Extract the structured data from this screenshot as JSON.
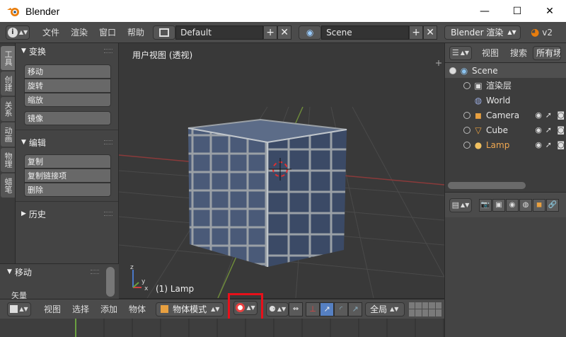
{
  "window": {
    "title": "Blender",
    "minimize": "—",
    "maximize": "☐",
    "close": "✕"
  },
  "topbar": {
    "info_icon": "i",
    "menus": [
      "文件",
      "渲染",
      "窗口",
      "帮助"
    ],
    "screen_layout": "Default",
    "scene": "Scene",
    "render_engine": "Blender 渲染",
    "version": "v2"
  },
  "left_tabs": [
    "工具",
    "创建",
    "关系",
    "动画",
    "物理",
    "蜡笔"
  ],
  "toolshelf": {
    "transform_header": "变换",
    "transform_buttons": [
      "移动",
      "旋转",
      "缩放"
    ],
    "mirror_button": "镜像",
    "edit_header": "编辑",
    "edit_buttons": [
      "复制",
      "复制链接项",
      "删除"
    ],
    "history_header": "历史"
  },
  "last_operator": {
    "header": "移动",
    "field_label": "矢量"
  },
  "viewport": {
    "title": "用户视图 (透视)",
    "active_object": "(1) Lamp",
    "axis_x": "x",
    "axis_y": "y",
    "axis_z": "z"
  },
  "bottom_header": {
    "menus": [
      "视图",
      "选择",
      "添加",
      "物体"
    ],
    "mode": "物体模式",
    "orientation": "全局"
  },
  "outliner": {
    "view_menu": "视图",
    "search_menu": "搜索",
    "filter": "所有场",
    "rows": [
      {
        "label": "Scene",
        "icon": "scene-icon"
      },
      {
        "label": "渲染层",
        "icon": "render-layer-icon"
      },
      {
        "label": "World",
        "icon": "world-icon"
      },
      {
        "label": "Camera",
        "icon": "camera-icon"
      },
      {
        "label": "Cube",
        "icon": "mesh-icon"
      },
      {
        "label": "Lamp",
        "icon": "lamp-icon"
      }
    ]
  },
  "colors": {
    "accent_orange": "#e87d0d",
    "selection_blue": "#5680c2",
    "highlight_red": "#e8101a",
    "cube_blue": "#4a5a78"
  }
}
